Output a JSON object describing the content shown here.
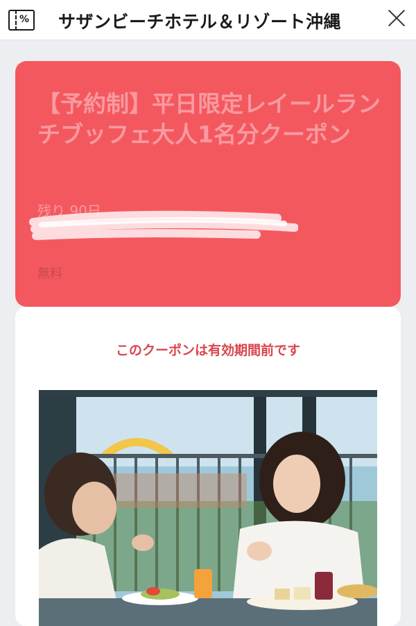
{
  "header": {
    "title": "サザンビーチホテル＆リゾート沖縄",
    "coupon_icon_symbol": "%",
    "icons": [
      "coupon-icon",
      "close-icon"
    ]
  },
  "coupon": {
    "title": "【予約制】平日限定レイールランチブッフェ大人1名分クーポン",
    "remaining": "残り 90日",
    "price": "無料",
    "color": "#f4585f"
  },
  "detail": {
    "status": "このクーポンは有効期間前です",
    "status_color": "#d9464d"
  }
}
